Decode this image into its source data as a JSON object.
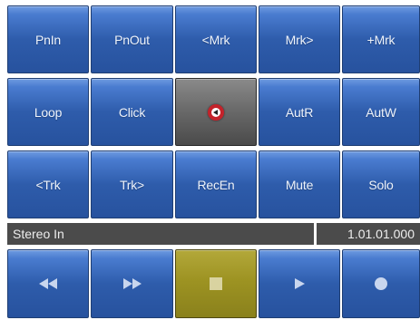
{
  "buttons": {
    "punch_in": "PnIn",
    "punch_out": "PnOut",
    "prev_marker": "<Mrk",
    "next_marker": "Mrk>",
    "add_marker": "+Mrk",
    "loop": "Loop",
    "click": "Click",
    "auto_read": "AutR",
    "auto_write": "AutW",
    "prev_track": "<Trk",
    "next_track": "Trk>",
    "record_enable": "RecEn",
    "mute": "Mute",
    "solo": "Solo"
  },
  "status": {
    "track_name": "Stereo In",
    "position": "1.01.01.000"
  },
  "transport": {
    "rewind_icon": "rewind-icon",
    "fast_forward_icon": "fast-forward-icon",
    "stop_icon": "stop-icon",
    "play_icon": "play-icon",
    "record_icon": "record-icon",
    "active": "stop"
  },
  "colors": {
    "button_blue": "#2e5cab",
    "active_olive": "#9d9322",
    "status_bg": "#4b4b4b",
    "center_button_gray": "#6b6b6b",
    "center_icon_red": "#c4222a"
  }
}
